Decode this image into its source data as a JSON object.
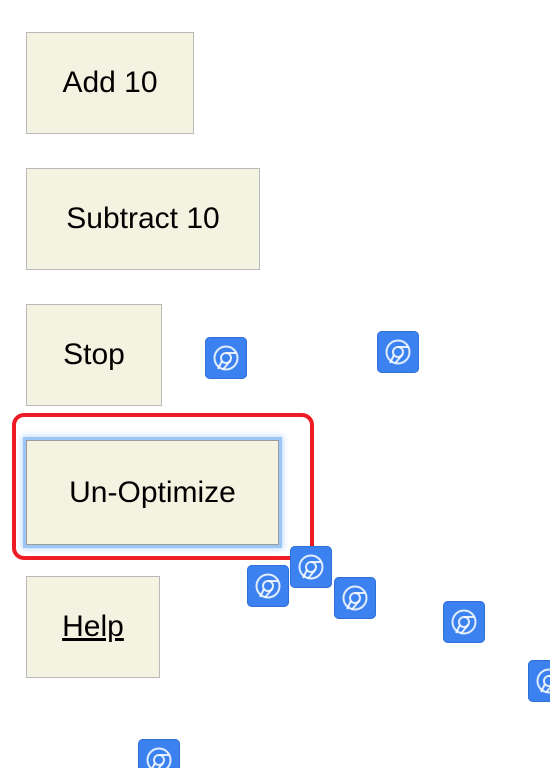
{
  "buttons": {
    "add": "Add 10",
    "subtract": "Subtract 10",
    "stop": "Stop",
    "unoptimize": "Un-Optimize",
    "help": "Help"
  },
  "icons": {
    "floating_icon": "chrome-icon",
    "count": 9
  },
  "colors": {
    "button_bg": "#f4f2e0",
    "icon_bg": "#3b82f0",
    "highlight": "#ee1c25",
    "focus_ring": "#9cc6f6"
  }
}
